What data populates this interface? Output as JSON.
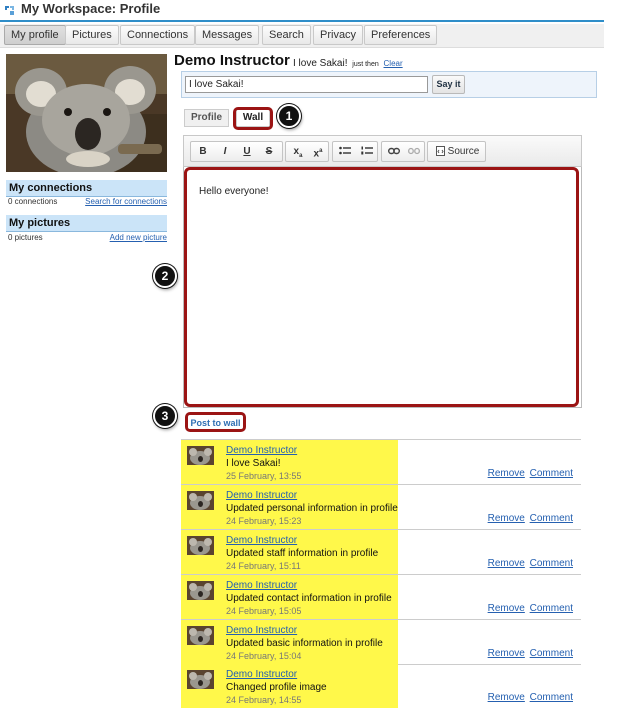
{
  "titlebar": {
    "title": "My Workspace: Profile"
  },
  "nav": {
    "items": [
      "My profile",
      "Pictures",
      "Connections",
      "Messages",
      "Search",
      "Privacy",
      "Preferences"
    ]
  },
  "sidebar": {
    "connections": {
      "title": "My connections",
      "count": "0 connections",
      "link": "Search for connections"
    },
    "pictures": {
      "title": "My pictures",
      "count": "0 pictures",
      "link": "Add new picture"
    }
  },
  "header": {
    "name": "Demo Instructor",
    "status_text": "I love Sakai!",
    "status_time": "just then",
    "clear_label": "Clear"
  },
  "status_form": {
    "input_value": "I love Sakai!",
    "button_label": "Say it"
  },
  "tabs": [
    {
      "label": "Profile"
    },
    {
      "label": "Wall"
    }
  ],
  "callouts": [
    "1",
    "2",
    "3"
  ],
  "editor": {
    "toolbar": {
      "bold": "B",
      "italic": "I",
      "underline": "U",
      "strike": "S",
      "subscript": "x",
      "superscript": "x",
      "source_label": "Source"
    },
    "content": "Hello everyone!"
  },
  "post_button": {
    "label": "Post to wall"
  },
  "wall": {
    "remove_label": "Remove",
    "comment_label": "Comment",
    "items": [
      {
        "author": "Demo Instructor",
        "message": "I love Sakai!",
        "time": "25 February, 13:55"
      },
      {
        "author": "Demo Instructor",
        "message": "Updated personal information in profile",
        "time": "24 February, 15:23"
      },
      {
        "author": "Demo Instructor",
        "message": "Updated staff information in profile",
        "time": "24 February, 15:11"
      },
      {
        "author": "Demo Instructor",
        "message": "Updated contact information in profile",
        "time": "24 February, 15:05"
      },
      {
        "author": "Demo Instructor",
        "message": "Updated basic information in profile",
        "time": "24 February, 15:04"
      },
      {
        "author": "Demo Instructor",
        "message": "Changed profile image",
        "time": "24 February, 14:55"
      }
    ]
  }
}
